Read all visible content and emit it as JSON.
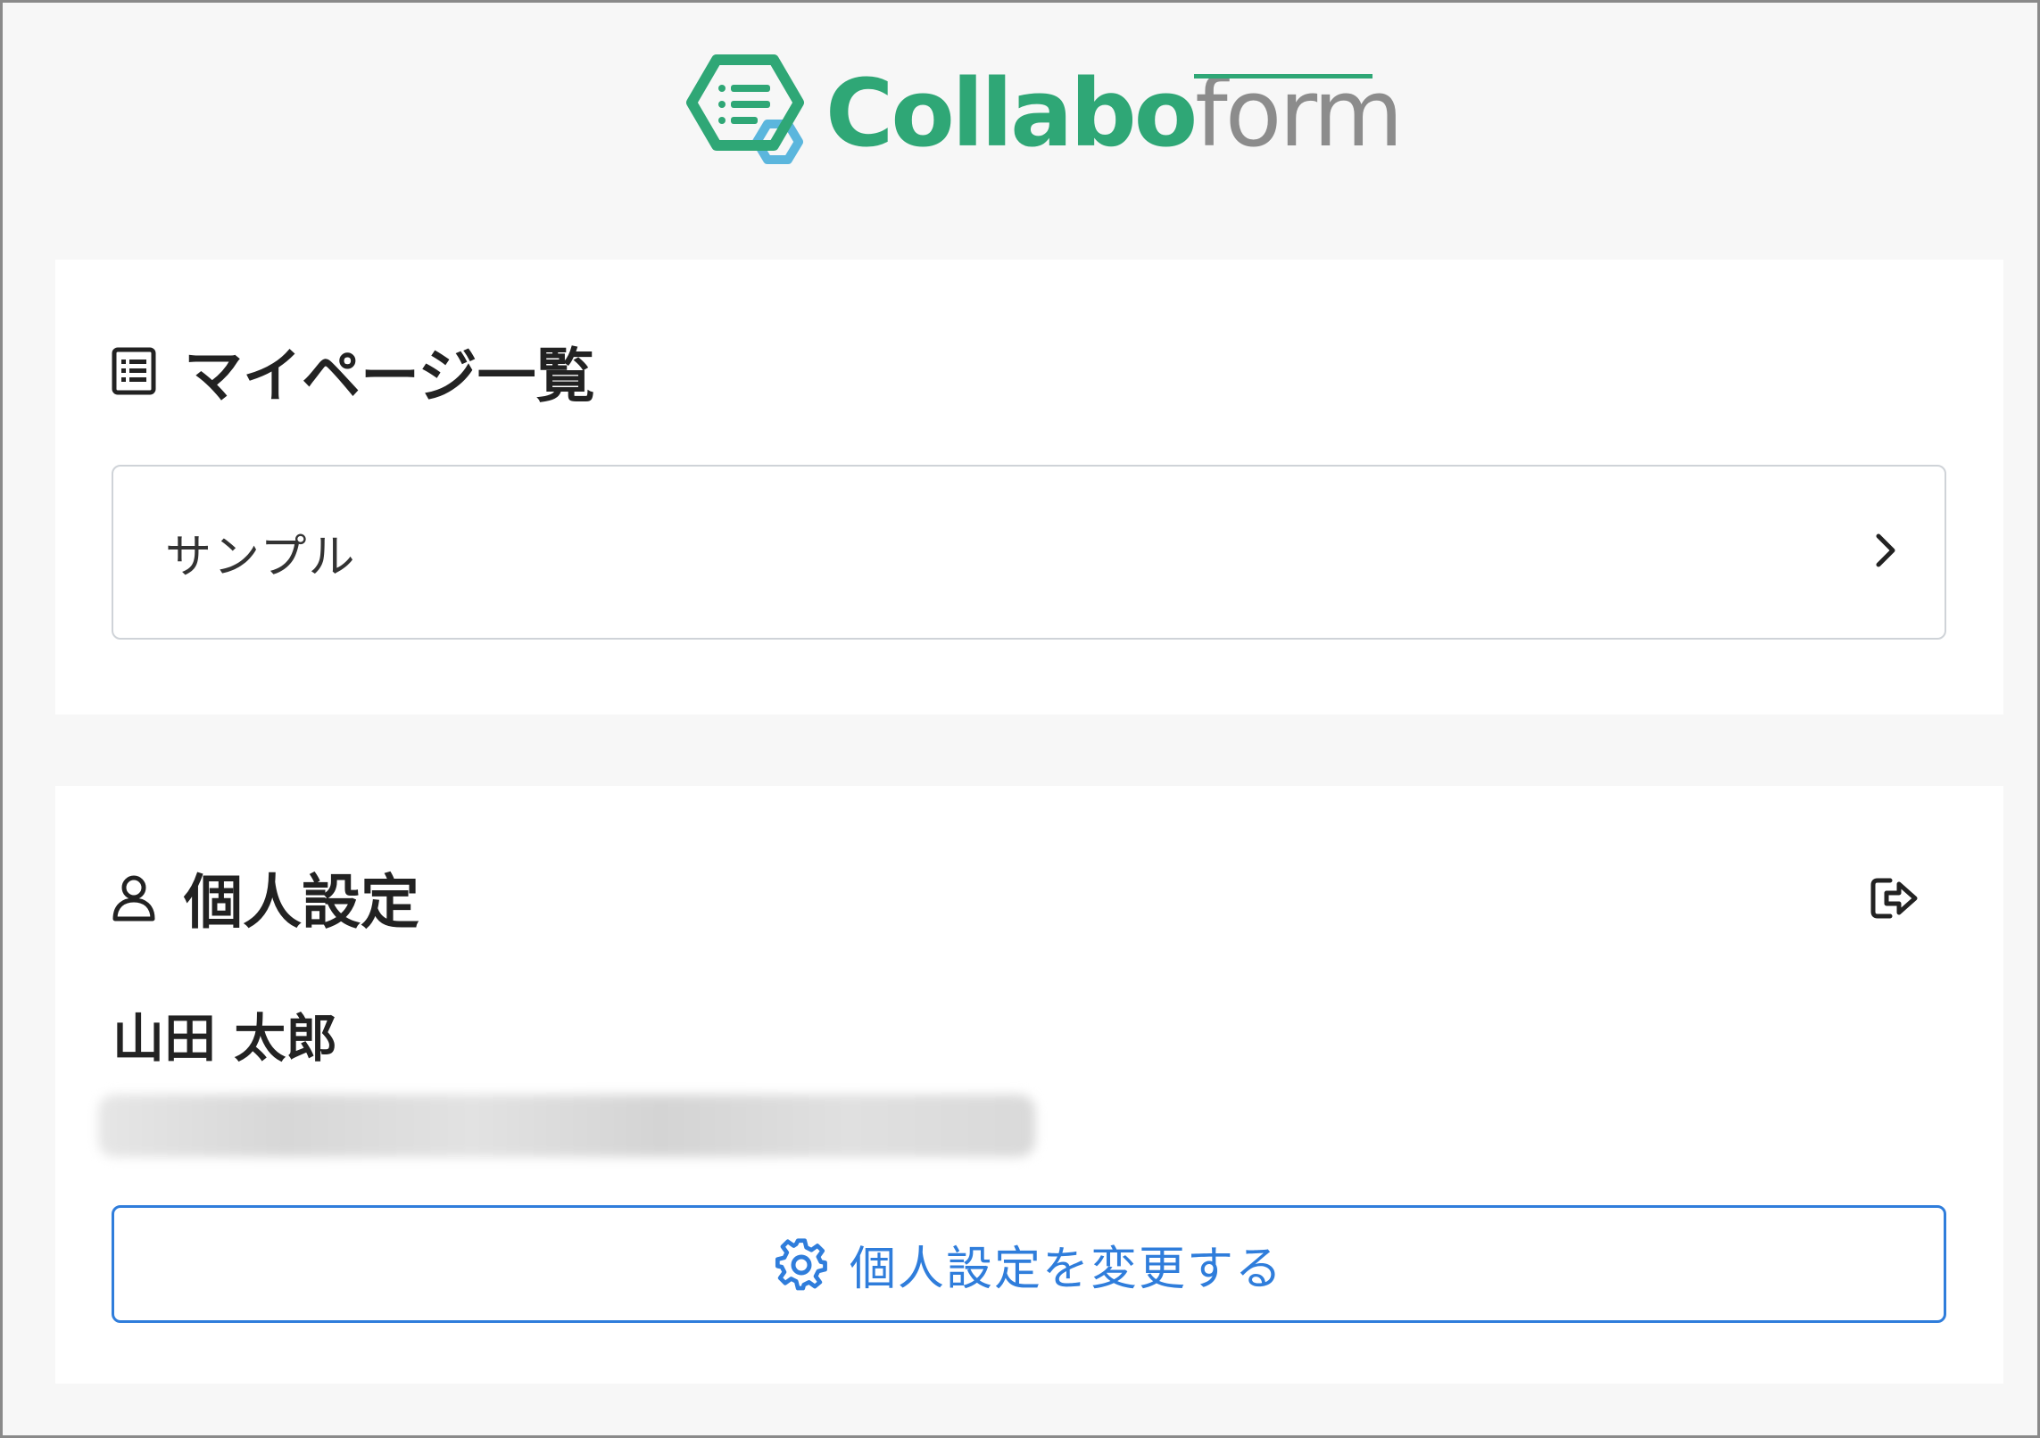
{
  "brand": {
    "logo_part1": "Collabo",
    "logo_part2": "form",
    "primary_color": "#2fa776",
    "secondary_color": "#8c8c8c",
    "icon_name": "collaboform-logo-icon"
  },
  "mypage_section": {
    "title": "マイページ一覧",
    "icon": "list-icon",
    "items": [
      {
        "label": "サンプル",
        "icon": "chevron-right-icon"
      }
    ]
  },
  "personal_section": {
    "title": "個人設定",
    "icon": "user-icon",
    "logout_icon": "logout-icon",
    "user_name": "山田 太郎",
    "email_masked": "",
    "settings_button": {
      "label": "個人設定を変更する",
      "icon": "gear-icon",
      "color": "#2f7ddb"
    }
  }
}
